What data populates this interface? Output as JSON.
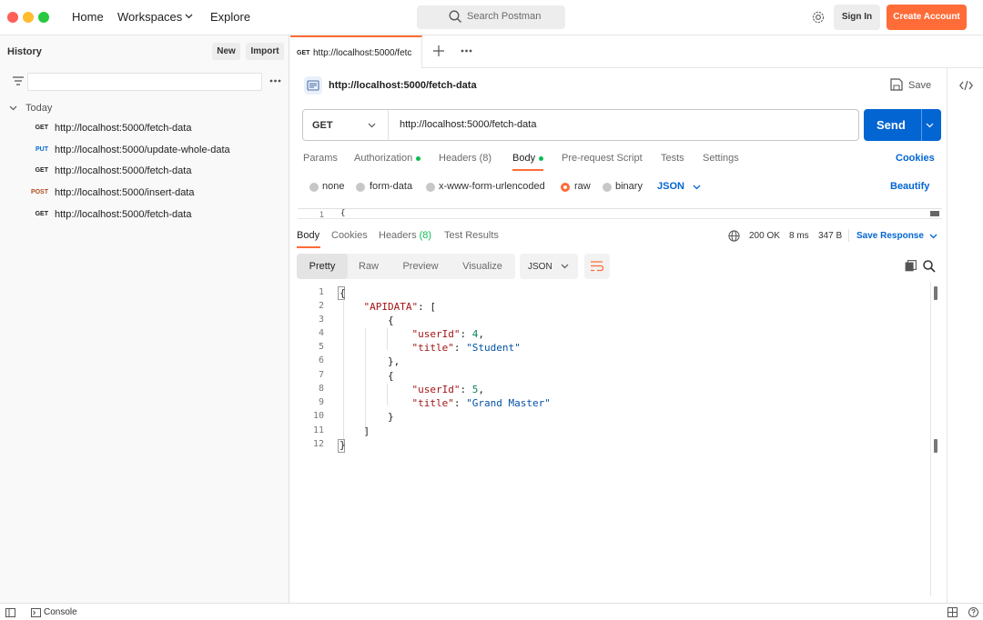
{
  "colors": {
    "accent": "#ff6c37",
    "primary": "#0265d2",
    "success": "#0cbb52"
  },
  "topbar": {
    "nav": [
      "Home",
      "Workspaces",
      "Explore"
    ],
    "search_placeholder": "Search Postman",
    "sign_in": "Sign In",
    "create_account": "Create Account"
  },
  "history": {
    "title": "History",
    "new_label": "New",
    "import_label": "Import",
    "group": "Today",
    "items": [
      {
        "method": "GET",
        "url": "http://localhost:5000/fetch-data",
        "color": "#212121"
      },
      {
        "method": "PUT",
        "url": "http://localhost:5000/update-whole-data",
        "color": "#0265d2"
      },
      {
        "method": "GET",
        "url": "http://localhost:5000/fetch-data",
        "color": "#212121"
      },
      {
        "method": "POST",
        "url": "http://localhost:5000/insert-data",
        "color": "#ad4d1f"
      },
      {
        "method": "GET",
        "url": "http://localhost:5000/fetch-data",
        "color": "#212121"
      }
    ]
  },
  "tab": {
    "method": "GET",
    "url": "http://localhost:5000/fetc"
  },
  "request": {
    "title": "http://localhost:5000/fetch-data",
    "save_label": "Save",
    "method": "GET",
    "url": "http://localhost:5000/fetch-data",
    "send_label": "Send",
    "tabs": {
      "params": "Params",
      "authorization": "Authorization",
      "headers": "Headers",
      "headers_count": "(8)",
      "body": "Body",
      "prerequest": "Pre-request Script",
      "tests": "Tests",
      "settings": "Settings",
      "cookies": "Cookies"
    },
    "body_types": [
      "none",
      "form-data",
      "x-www-form-urlencoded",
      "raw",
      "binary"
    ],
    "body_format": "JSON",
    "beautify": "Beautify",
    "editor_first_line_no": "1",
    "editor_first_line": "{"
  },
  "response": {
    "tabs": {
      "body": "Body",
      "cookies": "Cookies",
      "headers": "Headers",
      "headers_count": "(8)",
      "tests": "Test Results"
    },
    "status": "200 OK",
    "time": "8 ms",
    "size": "347 B",
    "save_response": "Save Response",
    "views": [
      "Pretty",
      "Raw",
      "Preview",
      "Visualize"
    ],
    "format": "JSON"
  },
  "footer": {
    "console": "Console"
  }
}
